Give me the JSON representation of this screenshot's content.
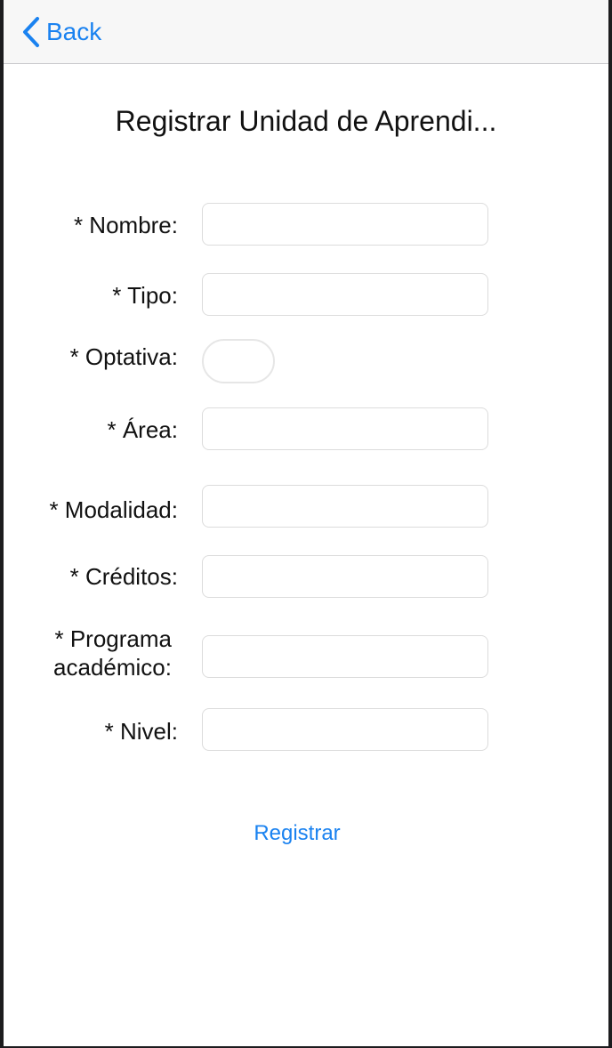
{
  "nav": {
    "back_label": "Back"
  },
  "page": {
    "title": "Registrar Unidad de Aprendi..."
  },
  "form": {
    "nombre": {
      "label": "* Nombre:",
      "value": ""
    },
    "tipo": {
      "label": "* Tipo:",
      "value": ""
    },
    "optativa": {
      "label": "* Optativa:"
    },
    "area": {
      "label": "* Área:",
      "value": ""
    },
    "modalidad": {
      "label": "* Modalidad:",
      "value": ""
    },
    "creditos": {
      "label": "* Créditos:",
      "value": ""
    },
    "programa": {
      "label_line1": "* Programa",
      "label_line2": "académico:",
      "value": ""
    },
    "nivel": {
      "label": "* Nivel:",
      "value": ""
    },
    "submit_label": "Registrar"
  },
  "colors": {
    "accent": "#1a82f0",
    "navbar": "#f7f7f7"
  },
  "icons": {
    "back": "chevron-left-icon"
  }
}
